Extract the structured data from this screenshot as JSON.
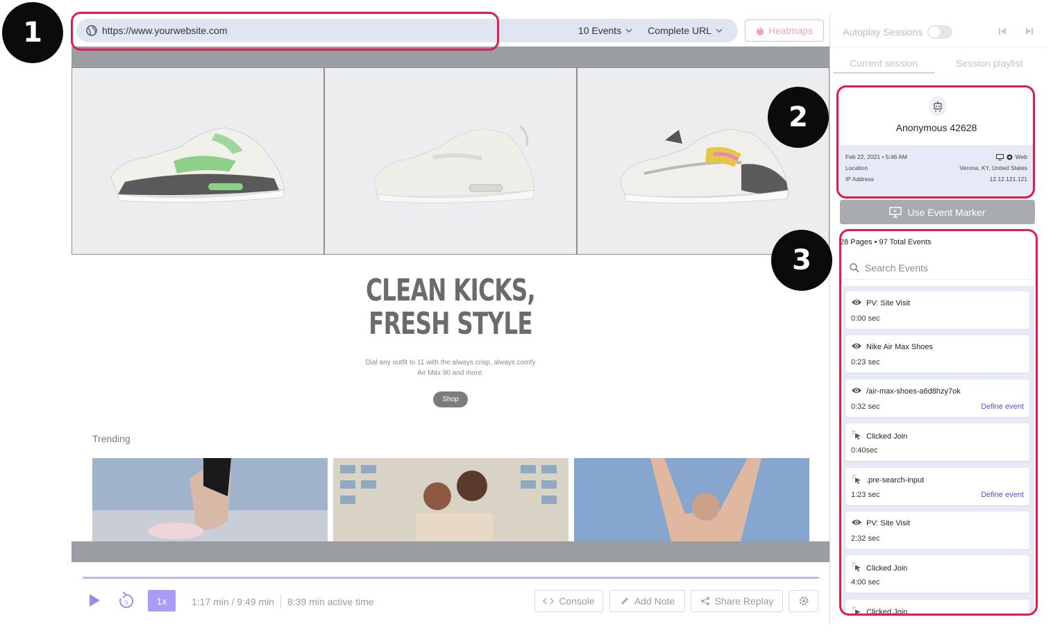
{
  "callouts": [
    "1",
    "2",
    "3"
  ],
  "urlbar": {
    "url": "https://www.yourwebsite.com",
    "events_select": "10 Events",
    "match_select": "Complete URL",
    "heatmaps_label": "Heatmaps"
  },
  "site": {
    "headline_line1": "CLEAN KICKS,",
    "headline_line2": "FRESH STYLE",
    "subtext_line1": "Dial any outfit to 11 with the always crisp, always comfy",
    "subtext_line2": "Air Max 90 and more.",
    "shop_label": "Shop",
    "trending_label": "Trending"
  },
  "player": {
    "speed": "1x",
    "time": "1:17 min / 9:49 min",
    "active_time": "8:39 min active time",
    "console_label": "Console",
    "add_note_label": "Add Note",
    "share_label": "Share Replay"
  },
  "panel": {
    "autoplay_label": "Autoplay Sessions",
    "tabs": [
      "Current session",
      "Session playlist"
    ],
    "visitor": {
      "name": "Anonymous 42628",
      "date": "Feb 22, 2021 • 5:46 AM",
      "platform": "Web",
      "location_label": "Location",
      "location": "Verona, KY, United States",
      "ip_label": "IP Address",
      "ip": "12.12.121.121"
    },
    "marker_label": "Use Event Marker",
    "summary": "28 Pages • 97 Total Events",
    "search_placeholder": "Search Events",
    "events": [
      {
        "icon": "eye-icon",
        "title": "PV: Site Visit",
        "time": "0:00 sec",
        "action": ""
      },
      {
        "icon": "eye-icon",
        "title": "Nike Air Max Shoes",
        "time": "0:23 sec",
        "action": ""
      },
      {
        "icon": "eye-icon",
        "title": "/air-max-shoes-a6d8hzy7ok",
        "time": "0:32 sec",
        "action": "Define event"
      },
      {
        "icon": "cursor-click-icon",
        "title": "Clicked Join",
        "time": "0:40sec",
        "action": ""
      },
      {
        "icon": "cursor-click-icon",
        "title": ".pre-search-input",
        "time": "1:23 sec",
        "action": "Define event"
      },
      {
        "icon": "eye-icon",
        "title": "PV: Site Visit",
        "time": "2:32 sec",
        "action": ""
      },
      {
        "icon": "cursor-click-icon",
        "title": "Clicked Join",
        "time": "4:00 sec",
        "action": ""
      },
      {
        "icon": "cursor-click-icon",
        "title": "Clicked Join",
        "time": "",
        "action": ""
      }
    ]
  },
  "colors": {
    "highlight": "#e8174f",
    "accent": "#a99bf6",
    "link": "#4b52d6",
    "panel_bg": "#e6eaf6"
  }
}
